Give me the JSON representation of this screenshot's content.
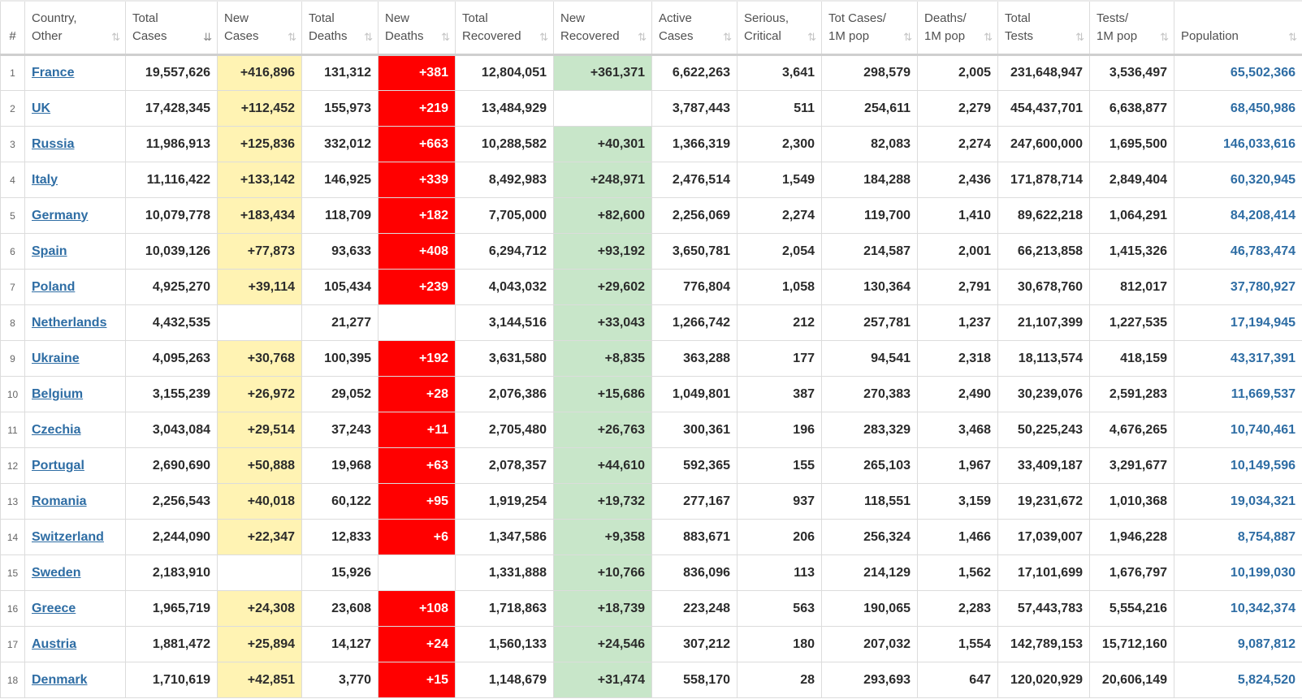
{
  "headers": {
    "idx": [
      "#"
    ],
    "country": [
      "Country,",
      "Other"
    ],
    "total_cases": [
      "Total",
      "Cases"
    ],
    "new_cases": [
      "New",
      "Cases"
    ],
    "total_deaths": [
      "Total",
      "Deaths"
    ],
    "new_deaths": [
      "New",
      "Deaths"
    ],
    "total_recovered": [
      "Total",
      "Recovered"
    ],
    "new_recovered": [
      "New",
      "Recovered"
    ],
    "active": [
      "Active",
      "Cases"
    ],
    "serious": [
      "Serious,",
      "Critical"
    ],
    "cases_per_m": [
      "Tot Cases/",
      "1M pop"
    ],
    "deaths_per_m": [
      "Deaths/",
      "1M pop"
    ],
    "total_tests": [
      "Total",
      "Tests"
    ],
    "tests_per_m": [
      "Tests/",
      "1M pop"
    ],
    "population": [
      "Population",
      ""
    ]
  },
  "sort_icon": "sort-arrows-icon",
  "colors": {
    "new_cases_bg": "#fff3b3",
    "new_deaths_bg": "#ff0000",
    "new_recovered_bg": "#c8e6c9",
    "link": "#2e6da4"
  },
  "rows": [
    {
      "idx": "1",
      "country": "France",
      "total_cases": "19,557,626",
      "new_cases": "+416,896",
      "total_deaths": "131,312",
      "new_deaths": "+381",
      "total_recovered": "12,804,051",
      "new_recovered": "+361,371",
      "active": "6,622,263",
      "serious": "3,641",
      "cases_per_m": "298,579",
      "deaths_per_m": "2,005",
      "total_tests": "231,648,947",
      "tests_per_m": "3,536,497",
      "population": "65,502,366"
    },
    {
      "idx": "2",
      "country": "UK",
      "total_cases": "17,428,345",
      "new_cases": "+112,452",
      "total_deaths": "155,973",
      "new_deaths": "+219",
      "total_recovered": "13,484,929",
      "new_recovered": "",
      "active": "3,787,443",
      "serious": "511",
      "cases_per_m": "254,611",
      "deaths_per_m": "2,279",
      "total_tests": "454,437,701",
      "tests_per_m": "6,638,877",
      "population": "68,450,986"
    },
    {
      "idx": "3",
      "country": "Russia",
      "total_cases": "11,986,913",
      "new_cases": "+125,836",
      "total_deaths": "332,012",
      "new_deaths": "+663",
      "total_recovered": "10,288,582",
      "new_recovered": "+40,301",
      "active": "1,366,319",
      "serious": "2,300",
      "cases_per_m": "82,083",
      "deaths_per_m": "2,274",
      "total_tests": "247,600,000",
      "tests_per_m": "1,695,500",
      "population": "146,033,616"
    },
    {
      "idx": "4",
      "country": "Italy",
      "total_cases": "11,116,422",
      "new_cases": "+133,142",
      "total_deaths": "146,925",
      "new_deaths": "+339",
      "total_recovered": "8,492,983",
      "new_recovered": "+248,971",
      "active": "2,476,514",
      "serious": "1,549",
      "cases_per_m": "184,288",
      "deaths_per_m": "2,436",
      "total_tests": "171,878,714",
      "tests_per_m": "2,849,404",
      "population": "60,320,945"
    },
    {
      "idx": "5",
      "country": "Germany",
      "total_cases": "10,079,778",
      "new_cases": "+183,434",
      "total_deaths": "118,709",
      "new_deaths": "+182",
      "total_recovered": "7,705,000",
      "new_recovered": "+82,600",
      "active": "2,256,069",
      "serious": "2,274",
      "cases_per_m": "119,700",
      "deaths_per_m": "1,410",
      "total_tests": "89,622,218",
      "tests_per_m": "1,064,291",
      "population": "84,208,414"
    },
    {
      "idx": "6",
      "country": "Spain",
      "total_cases": "10,039,126",
      "new_cases": "+77,873",
      "total_deaths": "93,633",
      "new_deaths": "+408",
      "total_recovered": "6,294,712",
      "new_recovered": "+93,192",
      "active": "3,650,781",
      "serious": "2,054",
      "cases_per_m": "214,587",
      "deaths_per_m": "2,001",
      "total_tests": "66,213,858",
      "tests_per_m": "1,415,326",
      "population": "46,783,474"
    },
    {
      "idx": "7",
      "country": "Poland",
      "total_cases": "4,925,270",
      "new_cases": "+39,114",
      "total_deaths": "105,434",
      "new_deaths": "+239",
      "total_recovered": "4,043,032",
      "new_recovered": "+29,602",
      "active": "776,804",
      "serious": "1,058",
      "cases_per_m": "130,364",
      "deaths_per_m": "2,791",
      "total_tests": "30,678,760",
      "tests_per_m": "812,017",
      "population": "37,780,927"
    },
    {
      "idx": "8",
      "country": "Netherlands",
      "total_cases": "4,432,535",
      "new_cases": "",
      "total_deaths": "21,277",
      "new_deaths": "",
      "total_recovered": "3,144,516",
      "new_recovered": "+33,043",
      "active": "1,266,742",
      "serious": "212",
      "cases_per_m": "257,781",
      "deaths_per_m": "1,237",
      "total_tests": "21,107,399",
      "tests_per_m": "1,227,535",
      "population": "17,194,945"
    },
    {
      "idx": "9",
      "country": "Ukraine",
      "total_cases": "4,095,263",
      "new_cases": "+30,768",
      "total_deaths": "100,395",
      "new_deaths": "+192",
      "total_recovered": "3,631,580",
      "new_recovered": "+8,835",
      "active": "363,288",
      "serious": "177",
      "cases_per_m": "94,541",
      "deaths_per_m": "2,318",
      "total_tests": "18,113,574",
      "tests_per_m": "418,159",
      "population": "43,317,391"
    },
    {
      "idx": "10",
      "country": "Belgium",
      "total_cases": "3,155,239",
      "new_cases": "+26,972",
      "total_deaths": "29,052",
      "new_deaths": "+28",
      "total_recovered": "2,076,386",
      "new_recovered": "+15,686",
      "active": "1,049,801",
      "serious": "387",
      "cases_per_m": "270,383",
      "deaths_per_m": "2,490",
      "total_tests": "30,239,076",
      "tests_per_m": "2,591,283",
      "population": "11,669,537"
    },
    {
      "idx": "11",
      "country": "Czechia",
      "total_cases": "3,043,084",
      "new_cases": "+29,514",
      "total_deaths": "37,243",
      "new_deaths": "+11",
      "total_recovered": "2,705,480",
      "new_recovered": "+26,763",
      "active": "300,361",
      "serious": "196",
      "cases_per_m": "283,329",
      "deaths_per_m": "3,468",
      "total_tests": "50,225,243",
      "tests_per_m": "4,676,265",
      "population": "10,740,461"
    },
    {
      "idx": "12",
      "country": "Portugal",
      "total_cases": "2,690,690",
      "new_cases": "+50,888",
      "total_deaths": "19,968",
      "new_deaths": "+63",
      "total_recovered": "2,078,357",
      "new_recovered": "+44,610",
      "active": "592,365",
      "serious": "155",
      "cases_per_m": "265,103",
      "deaths_per_m": "1,967",
      "total_tests": "33,409,187",
      "tests_per_m": "3,291,677",
      "population": "10,149,596"
    },
    {
      "idx": "13",
      "country": "Romania",
      "total_cases": "2,256,543",
      "new_cases": "+40,018",
      "total_deaths": "60,122",
      "new_deaths": "+95",
      "total_recovered": "1,919,254",
      "new_recovered": "+19,732",
      "active": "277,167",
      "serious": "937",
      "cases_per_m": "118,551",
      "deaths_per_m": "3,159",
      "total_tests": "19,231,672",
      "tests_per_m": "1,010,368",
      "population": "19,034,321"
    },
    {
      "idx": "14",
      "country": "Switzerland",
      "total_cases": "2,244,090",
      "new_cases": "+22,347",
      "total_deaths": "12,833",
      "new_deaths": "+6",
      "total_recovered": "1,347,586",
      "new_recovered": "+9,358",
      "active": "883,671",
      "serious": "206",
      "cases_per_m": "256,324",
      "deaths_per_m": "1,466",
      "total_tests": "17,039,007",
      "tests_per_m": "1,946,228",
      "population": "8,754,887"
    },
    {
      "idx": "15",
      "country": "Sweden",
      "total_cases": "2,183,910",
      "new_cases": "",
      "total_deaths": "15,926",
      "new_deaths": "",
      "total_recovered": "1,331,888",
      "new_recovered": "+10,766",
      "active": "836,096",
      "serious": "113",
      "cases_per_m": "214,129",
      "deaths_per_m": "1,562",
      "total_tests": "17,101,699",
      "tests_per_m": "1,676,797",
      "population": "10,199,030"
    },
    {
      "idx": "16",
      "country": "Greece",
      "total_cases": "1,965,719",
      "new_cases": "+24,308",
      "total_deaths": "23,608",
      "new_deaths": "+108",
      "total_recovered": "1,718,863",
      "new_recovered": "+18,739",
      "active": "223,248",
      "serious": "563",
      "cases_per_m": "190,065",
      "deaths_per_m": "2,283",
      "total_tests": "57,443,783",
      "tests_per_m": "5,554,216",
      "population": "10,342,374"
    },
    {
      "idx": "17",
      "country": "Austria",
      "total_cases": "1,881,472",
      "new_cases": "+25,894",
      "total_deaths": "14,127",
      "new_deaths": "+24",
      "total_recovered": "1,560,133",
      "new_recovered": "+24,546",
      "active": "307,212",
      "serious": "180",
      "cases_per_m": "207,032",
      "deaths_per_m": "1,554",
      "total_tests": "142,789,153",
      "tests_per_m": "15,712,160",
      "population": "9,087,812"
    },
    {
      "idx": "18",
      "country": "Denmark",
      "total_cases": "1,710,619",
      "new_cases": "+42,851",
      "total_deaths": "3,770",
      "new_deaths": "+15",
      "total_recovered": "1,148,679",
      "new_recovered": "+31,474",
      "active": "558,170",
      "serious": "28",
      "cases_per_m": "293,693",
      "deaths_per_m": "647",
      "total_tests": "120,020,929",
      "tests_per_m": "20,606,149",
      "population": "5,824,520"
    }
  ]
}
